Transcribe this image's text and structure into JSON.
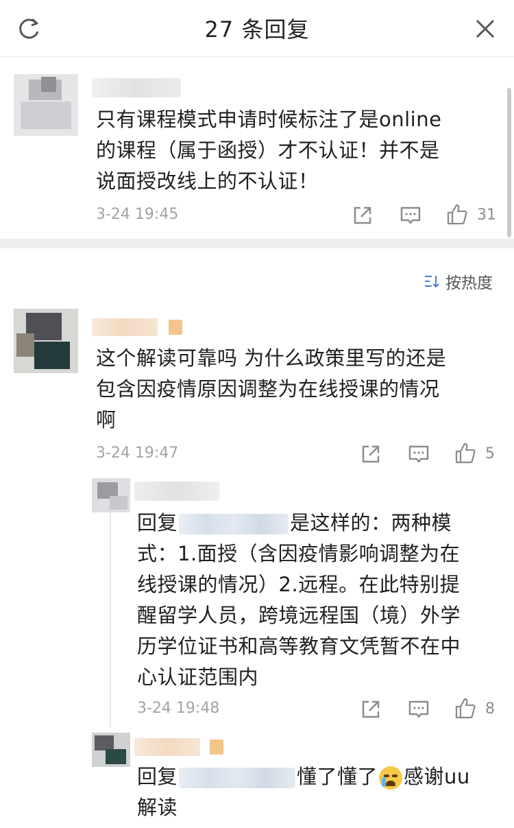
{
  "header": {
    "title": "27 条回复",
    "refresh_icon": "refresh-icon",
    "close_icon": "close-icon"
  },
  "main_comment": {
    "text_lines": [
      "只有课程模式申请时候标注了是online",
      "的课程（属于函授）才不认证！并不是",
      "说面授改线上的不认证！"
    ],
    "time": "3-24 19:45",
    "like_count": "31"
  },
  "sort": {
    "label": "按热度",
    "icon": "sort-icon"
  },
  "replies": [
    {
      "text_lines": [
        "这个解读可靠吗 为什么政策里写的还是",
        "包含因疫情原因调整为在线授课的情况",
        "啊"
      ],
      "time": "3-24 19:47",
      "like_count": "5"
    },
    {
      "prefix": "回复",
      "first_line_rest": "是这样的：两种模",
      "text_lines": [
        "式：1.面授（含因疫情影响调整为在",
        "线授课的情况）2.远程。在此特别提",
        "醒留学人员，跨境远程国（境）外学",
        "历学位证书和高等教育文凭暂不在中",
        "心认证范围内"
      ],
      "time": "3-24 19:48",
      "like_count": "8"
    },
    {
      "prefix": "回复",
      "first_line_rest_a": "懂了懂了",
      "emoji": "crying-emoji",
      "first_line_rest_b": "感谢uu",
      "text_lines": [
        "解读"
      ]
    }
  ],
  "colors": {
    "text": "#1f1f1f",
    "meta": "#a3a3a3",
    "divider": "#efefef"
  }
}
